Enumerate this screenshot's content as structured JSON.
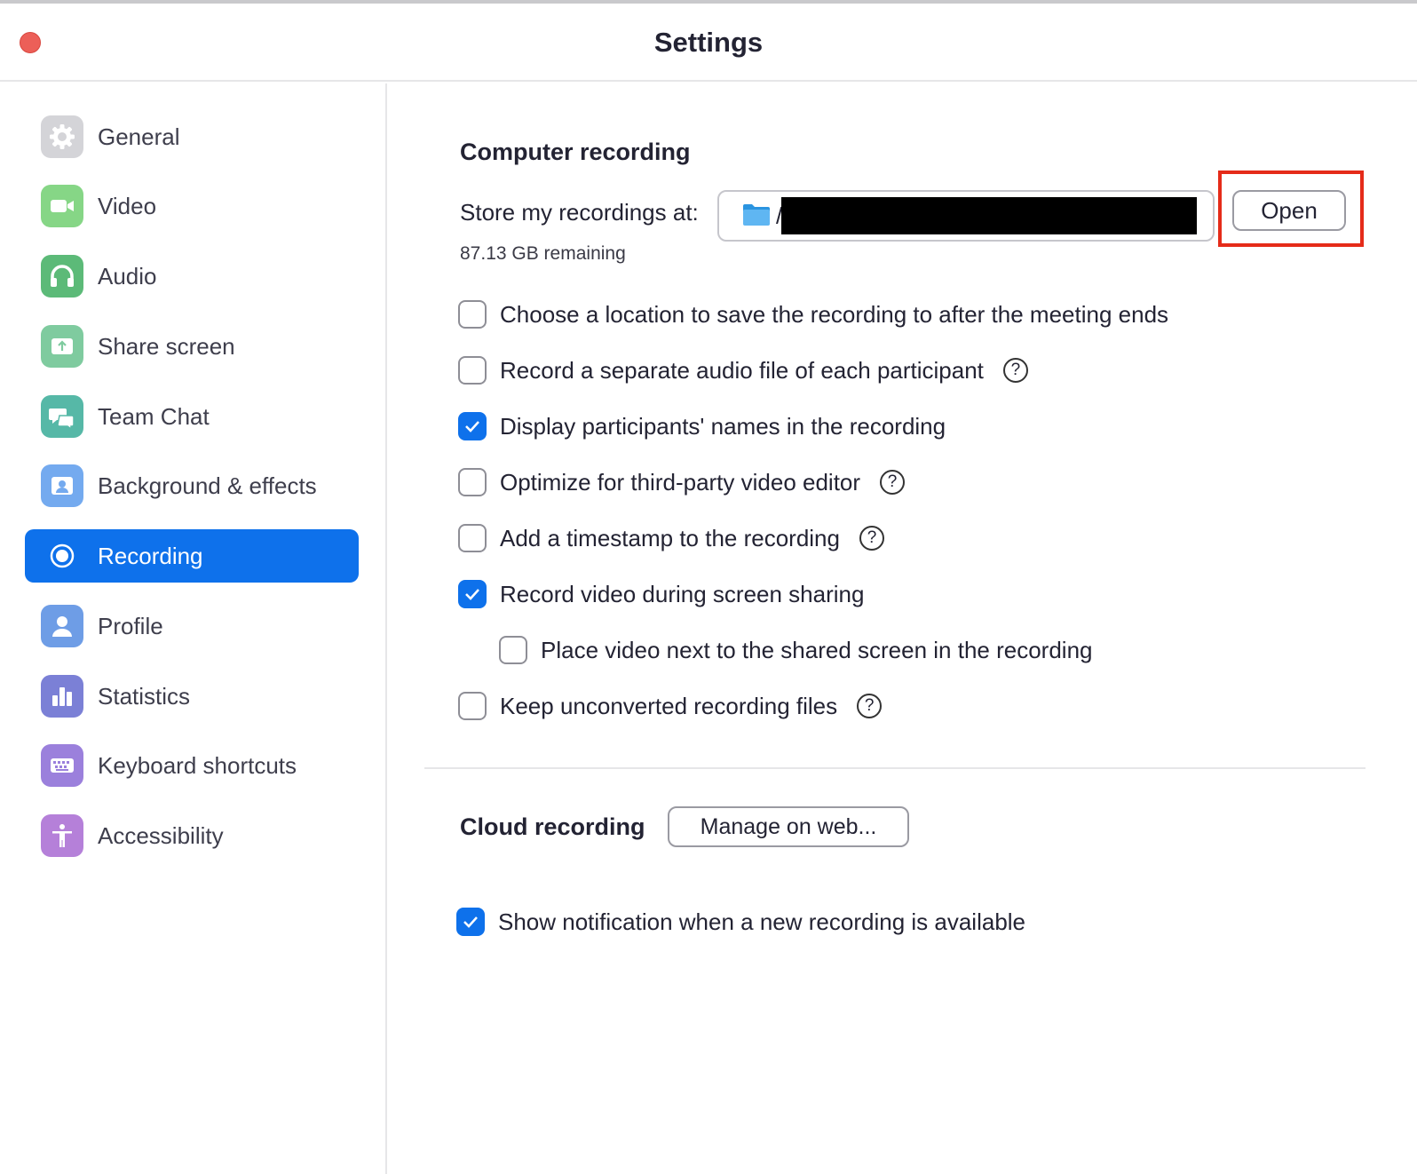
{
  "window": {
    "title": "Settings"
  },
  "sidebar": {
    "items": [
      {
        "label": "General",
        "icon": "gear-icon",
        "color": "#cfcfd4"
      },
      {
        "label": "Video",
        "icon": "video-camera-icon",
        "color": "#7fd27f"
      },
      {
        "label": "Audio",
        "icon": "headphones-icon",
        "color": "#5cb87a"
      },
      {
        "label": "Share screen",
        "icon": "share-screen-icon",
        "color": "#79c9a0"
      },
      {
        "label": "Team Chat",
        "icon": "chat-bubbles-icon",
        "color": "#55b7a6"
      },
      {
        "label": "Background & effects",
        "icon": "background-person-icon",
        "color": "#6fa8ef"
      },
      {
        "label": "Recording",
        "icon": "record-icon",
        "color": "#0e71eb",
        "active": true
      },
      {
        "label": "Profile",
        "icon": "profile-icon",
        "color": "#6b9be6"
      },
      {
        "label": "Statistics",
        "icon": "bar-chart-icon",
        "color": "#7a7fd6"
      },
      {
        "label": "Keyboard shortcuts",
        "icon": "keyboard-icon",
        "color": "#9a7fdc"
      },
      {
        "label": "Accessibility",
        "icon": "accessibility-icon",
        "color": "#b57fd9"
      }
    ]
  },
  "computer_recording": {
    "title": "Computer recording",
    "store_label": "Store my recordings at:",
    "path_prefix": "/",
    "open_label": "Open",
    "remaining": "87.13 GB remaining",
    "options": [
      {
        "label": "Choose a location to save the recording to after the meeting ends",
        "checked": false,
        "help": false
      },
      {
        "label": "Record a separate audio file of each participant",
        "checked": false,
        "help": true
      },
      {
        "label": "Display participants' names in the recording",
        "checked": true,
        "help": false
      },
      {
        "label": "Optimize for third-party video editor",
        "checked": false,
        "help": true
      },
      {
        "label": "Add a timestamp to the recording",
        "checked": false,
        "help": true
      },
      {
        "label": "Record video during screen sharing",
        "checked": true,
        "help": false
      },
      {
        "label": "Place video next to the shared screen in the recording",
        "checked": false,
        "help": false,
        "indent": true
      },
      {
        "label": "Keep unconverted recording files",
        "checked": false,
        "help": true
      }
    ]
  },
  "cloud_recording": {
    "title": "Cloud recording",
    "manage_label": "Manage on web...",
    "notify": {
      "label": "Show notification when a new recording is available",
      "checked": true
    }
  },
  "help_glyph": "?",
  "colors": {
    "accent": "#0e71eb",
    "highlight": "#e52b19",
    "close": "#ec5f58"
  }
}
